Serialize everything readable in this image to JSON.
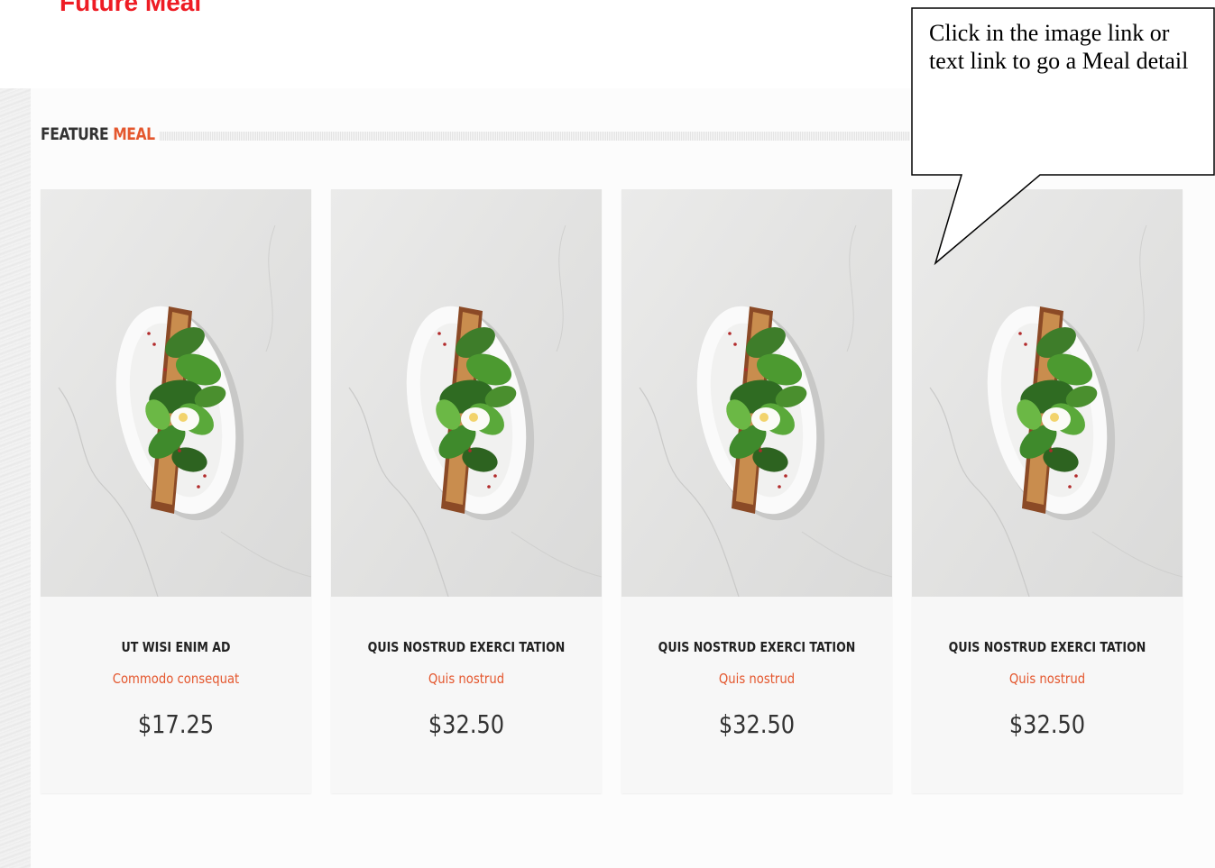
{
  "doc_title": "Future Meal",
  "section": {
    "heading_part1": "FEATURE",
    "heading_part2": "MEAL"
  },
  "callout": {
    "text": "Click in the image link or text link to go a Meal detail"
  },
  "meals": [
    {
      "name": "UT WISI ENIM AD",
      "subtitle": "Commodo consequat",
      "price": "$17.25"
    },
    {
      "name": "QUIS NOSTRUD EXERCI TATION",
      "subtitle": "Quis nostrud",
      "price": "$32.50"
    },
    {
      "name": "QUIS NOSTRUD EXERCI TATION",
      "subtitle": "Quis nostrud",
      "price": "$32.50"
    },
    {
      "name": "QUIS NOSTRUD EXERCI TATION",
      "subtitle": "Quis nostrud",
      "price": "$32.50"
    }
  ],
  "colors": {
    "title_red": "#ee1c24",
    "accent": "#e4572e",
    "card_bg": "#f7f7f7"
  },
  "icons": {
    "meal_image": "food-plate-image"
  }
}
